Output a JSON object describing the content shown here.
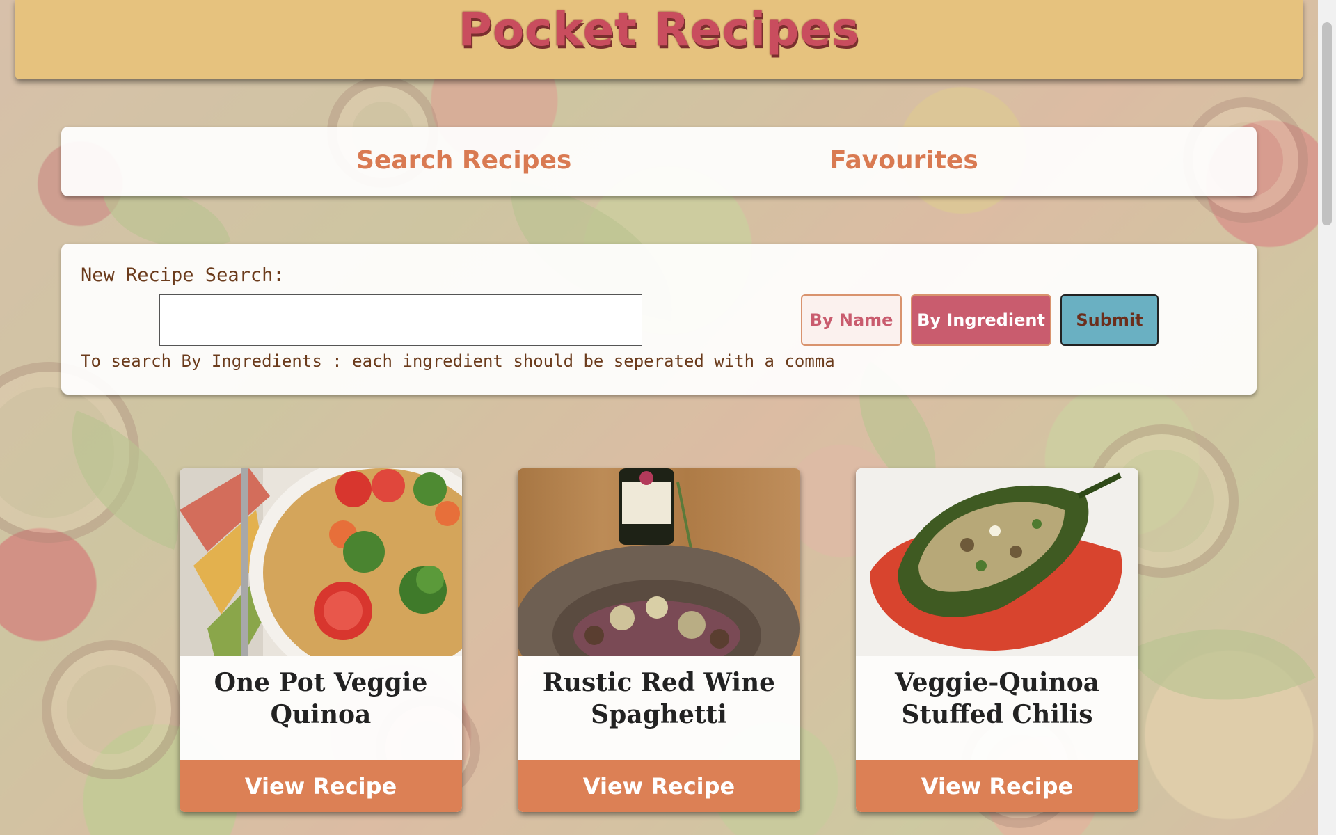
{
  "header": {
    "title": "Pocket Recipes"
  },
  "nav": {
    "search_label": "Search Recipes",
    "favourites_label": "Favourites"
  },
  "search": {
    "label": "New Recipe Search:",
    "input_value": "",
    "help_text": "To search By Ingredients : each ingredient should be seperated with a comma",
    "by_name_label": "By Name",
    "by_ingredient_label": "By Ingredient",
    "submit_label": "Submit",
    "active_mode": "By Ingredient"
  },
  "recipes": [
    {
      "title": "One Pot Veggie Quinoa",
      "button_label": "View Recipe",
      "image": "veggie-quinoa-bowl"
    },
    {
      "title": "Rustic Red Wine Spaghetti",
      "button_label": "View Recipe",
      "image": "red-wine-spaghetti-plate"
    },
    {
      "title": "Veggie-Quinoa Stuffed Chilis",
      "button_label": "View Recipe",
      "image": "stuffed-chili-pepper"
    }
  ],
  "colors": {
    "header_bg": "#e6c27e",
    "title": "#c94d5e",
    "nav_link": "#d97a52",
    "label_text": "#6b3b1c",
    "by_ingredient_bg": "#c95c6e",
    "submit_bg": "#6ab0c2",
    "card_button_bg": "#dc8055"
  }
}
